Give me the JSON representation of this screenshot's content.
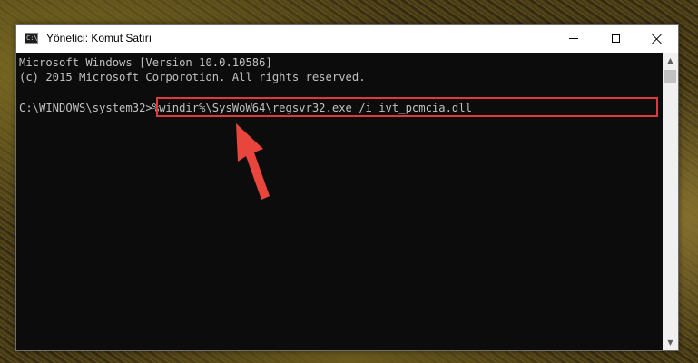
{
  "window": {
    "title": "Yönetici: Komut Satırı",
    "controls": [
      "minimize-icon",
      "maximize-icon",
      "close-icon"
    ]
  },
  "console": {
    "line1": "Microsoft Windows [Version 10.0.10586]",
    "line2": "(c) 2015 Microsoft Corporotion. All rights reserved.",
    "prompt": "C:\\WINDOWS\\system32>",
    "command": "%windir%\\SysWoW64\\regsvr32.exe /i ivt_pcmcia.dll"
  },
  "colors": {
    "console_bg": "#0c0c0c",
    "console_text": "#c0c0c0",
    "highlight": "#e0393b",
    "arrow": "#e8453c"
  },
  "annotation": {
    "icon": "red-arrow-icon"
  }
}
